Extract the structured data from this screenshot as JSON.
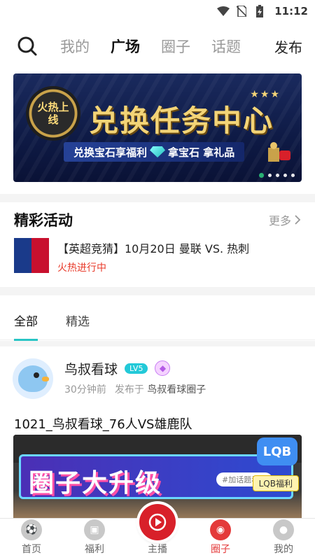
{
  "status_bar": {
    "time": "11:12"
  },
  "top_nav": {
    "tabs": [
      {
        "label": "我的",
        "active": false
      },
      {
        "label": "广场",
        "active": true
      },
      {
        "label": "圈子",
        "active": false
      },
      {
        "label": "话题",
        "active": false
      }
    ],
    "publish_label": "发布"
  },
  "banner": {
    "medal_text": "火热上线",
    "headline": "兑换任务中心",
    "subline_part1": "兑换宝石享福利",
    "subline_part2": "拿宝石 拿礼品",
    "page_count": 5,
    "active_page": 1
  },
  "activities": {
    "title": "精彩活动",
    "more_label": "更多",
    "items": [
      {
        "title": "【英超竞猜】10月20日 曼联 VS. 热刺",
        "status": "火热进行中"
      }
    ]
  },
  "filter_tabs": [
    {
      "label": "全部",
      "active": true
    },
    {
      "label": "精选",
      "active": false
    }
  ],
  "post": {
    "username": "鸟叔看球",
    "level": "LV5",
    "time_ago": "30分钟前",
    "published_in_prefix": "发布于",
    "circle_name": "鸟叔看球圈子",
    "title": "1021_鸟叔看球_76人VS雄鹿队",
    "image": {
      "headline": "圈子大升级",
      "tag": "#加话题看帖",
      "lqb_logo": "LQB",
      "lqb_label": "LQB福利"
    }
  },
  "bottom_nav": [
    {
      "label": "首页",
      "active": false
    },
    {
      "label": "福利",
      "active": false
    },
    {
      "label": "主播",
      "active": false
    },
    {
      "label": "圈子",
      "active": true
    },
    {
      "label": "我的",
      "active": false
    }
  ],
  "colors": {
    "accent": "#29c5c5",
    "brand_red": "#e43a3a",
    "live_status": "#e83a2a"
  }
}
